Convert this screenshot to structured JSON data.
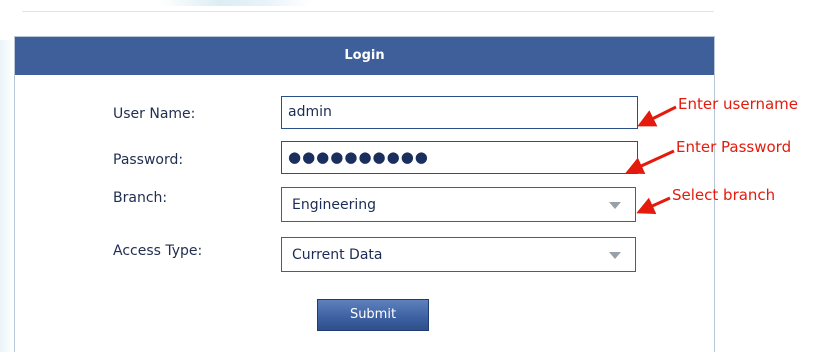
{
  "login": {
    "title": "Login",
    "fields": {
      "username_label": "User Name:",
      "username_value": "admin",
      "password_label": "Password:",
      "password_mask": "●●●●●●●●●●",
      "branch_label": "Branch:",
      "branch_value": "Engineering",
      "access_label": "Access Type:",
      "access_value": "Current Data"
    },
    "submit_label": "Submit"
  },
  "annotations": {
    "username": "Enter username",
    "password": "Enter Password",
    "branch": "Select branch"
  },
  "colors": {
    "header": "#3e5f9a",
    "annotation": "#e41a0c",
    "field_border": "#2a4f8a",
    "label_text": "#222f52"
  },
  "icons": {
    "dropdown": "chevron-down-icon",
    "annotation_arrow": "red-arrow-icon"
  }
}
